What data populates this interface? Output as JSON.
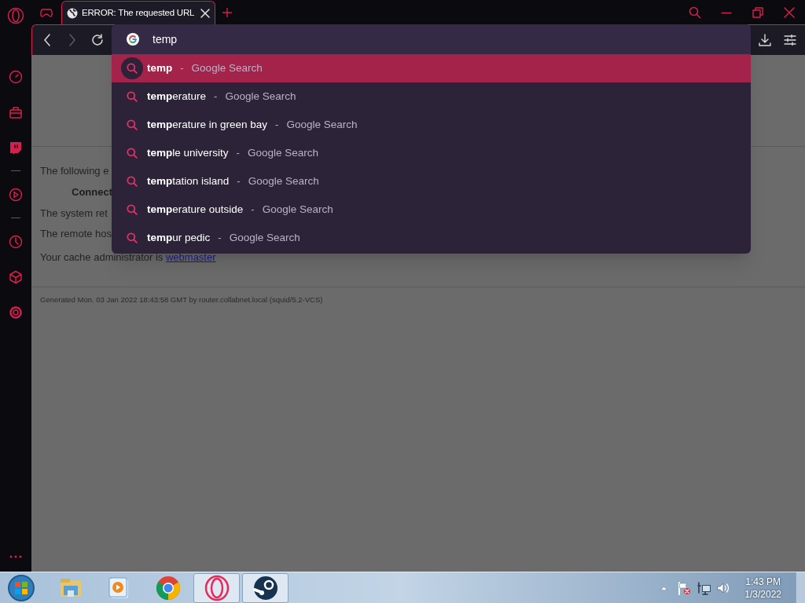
{
  "tab_bar": {
    "tabs": [
      {
        "title": "ERROR: The requested URL",
        "selected": true
      }
    ]
  },
  "address_bar": {
    "value": "temp"
  },
  "suggestions": [
    {
      "text": "**temp**",
      "separator": "-",
      "source": "Google Search",
      "selected": true
    },
    {
      "text": "**temp**erature",
      "separator": "-",
      "source": "Google Search",
      "selected": false
    },
    {
      "text": "**temp**erature in green bay",
      "separator": "-",
      "source": "Google Search",
      "selected": false
    },
    {
      "text": "**temp**le university",
      "separator": "-",
      "source": "Google Search",
      "selected": false
    },
    {
      "text": "**temp**tation island",
      "separator": "-",
      "source": "Google Search",
      "selected": false
    },
    {
      "text": "**temp**erature outside",
      "separator": "-",
      "source": "Google Search",
      "selected": false
    },
    {
      "text": "**temp**ur pedic",
      "separator": "-",
      "source": "Google Search",
      "selected": false
    }
  ],
  "page": {
    "lines": [
      {
        "kind": "text",
        "text": "The following e"
      },
      {
        "kind": "heading",
        "text": "Connect"
      },
      {
        "kind": "text",
        "text": "The system ret"
      },
      {
        "kind": "text",
        "text": "The remote hos"
      },
      {
        "kind": "link_line",
        "text": "Your cache administrator is",
        "link": "webmaster"
      }
    ],
    "footer": "Generated Mon. 03 Jan 2022 18:43:58 GMT by router.collabnet.local (squid/5.2-VCS)"
  },
  "taskbar": {
    "apps": [
      {
        "kind": "explorer",
        "active": false
      },
      {
        "kind": "media",
        "active": false
      },
      {
        "kind": "chrome",
        "active": false
      },
      {
        "kind": "opera",
        "active": true
      },
      {
        "kind": "steam",
        "active": true
      }
    ],
    "time": "1:43 PM",
    "date": "1/3/2022"
  }
}
